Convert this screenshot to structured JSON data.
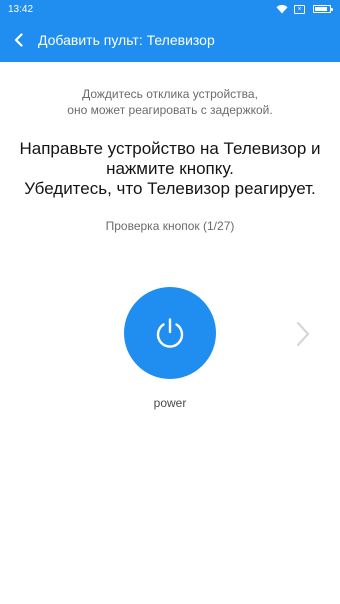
{
  "status_bar": {
    "time": "13:42",
    "icons": [
      "wifi-icon",
      "sim-off-icon",
      "battery-icon"
    ],
    "battery_level": 0.85
  },
  "app_bar": {
    "back_icon": "chevron-left-icon",
    "title": "Добавить пульт: Телевизор"
  },
  "main": {
    "hint_line1": "Дождитесь отклика устройства,",
    "hint_line2": "оно может реагировать с задержкой.",
    "instruction_line1": "Направьте устройство на Телевизор и",
    "instruction_line2": "нажмите кнопку.",
    "instruction_line3": "Убедитесь, что Телевизор реагирует.",
    "progress_text": "Проверка кнопок (1/27)",
    "button_icon": "power-icon",
    "button_label": "power",
    "next_icon": "chevron-right-icon"
  },
  "colors": {
    "accent": "#1f8ef0",
    "background": "#ffffff",
    "text_primary": "#141414",
    "text_secondary": "#6b6b6b",
    "chevron_disabled": "#d6d6d6"
  }
}
